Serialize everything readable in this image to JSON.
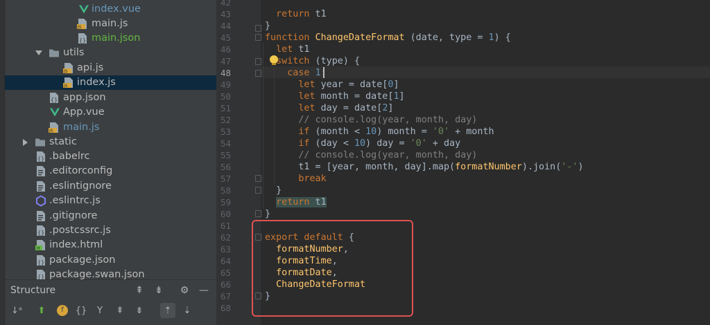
{
  "tree": {
    "items": [
      {
        "label": "index.vue",
        "color": "blue",
        "icon": "vue-icon"
      },
      {
        "label": "main.js",
        "color": "default",
        "icon": "js-file-icon"
      },
      {
        "label": "main.json",
        "color": "green",
        "icon": "json-file-icon"
      },
      {
        "label": "utils",
        "color": "default",
        "icon": "folder-icon"
      },
      {
        "label": "api.js",
        "color": "default",
        "icon": "js-file-icon"
      },
      {
        "label": "index.js",
        "color": "default",
        "icon": "js-file-icon"
      },
      {
        "label": "app.json",
        "color": "default",
        "icon": "json-file-icon"
      },
      {
        "label": "App.vue",
        "color": "default",
        "icon": "vue-icon"
      },
      {
        "label": "main.js",
        "color": "blue",
        "icon": "js-file-icon"
      },
      {
        "label": "static",
        "color": "default",
        "icon": "folder-icon"
      },
      {
        "label": ".babelrc",
        "color": "default",
        "icon": "json-file-icon"
      },
      {
        "label": ".editorconfig",
        "color": "default",
        "icon": "config-file-icon"
      },
      {
        "label": ".eslintignore",
        "color": "default",
        "icon": "text-file-icon"
      },
      {
        "label": ".eslintrc.js",
        "color": "default",
        "icon": "eslint-icon"
      },
      {
        "label": ".gitignore",
        "color": "default",
        "icon": "text-file-icon"
      },
      {
        "label": ".postcssrc.js",
        "color": "default",
        "icon": "js-file-icon"
      },
      {
        "label": "index.html",
        "color": "default",
        "icon": "html-file-icon"
      },
      {
        "label": "package.json",
        "color": "default",
        "icon": "json-file-icon"
      },
      {
        "label": "package.swan.json",
        "color": "default",
        "icon": "json-file-icon"
      }
    ]
  },
  "structure": {
    "title": "Structure"
  },
  "editor": {
    "line_numbers": [
      "42",
      "43",
      "44",
      "45",
      "46",
      "47",
      "48",
      "49",
      "50",
      "51",
      "52",
      "53",
      "54",
      "55",
      "56",
      "57",
      "58",
      "59",
      "60",
      "61",
      "62",
      "63",
      "64",
      "65",
      "66",
      "67",
      "68"
    ],
    "current_line": "48"
  },
  "colors": {
    "keyword": "#cc7832",
    "function": "#ffc66d",
    "number": "#6897bb",
    "string": "#6a8759",
    "comment": "#808080",
    "highlight_box": "#e05252"
  }
}
